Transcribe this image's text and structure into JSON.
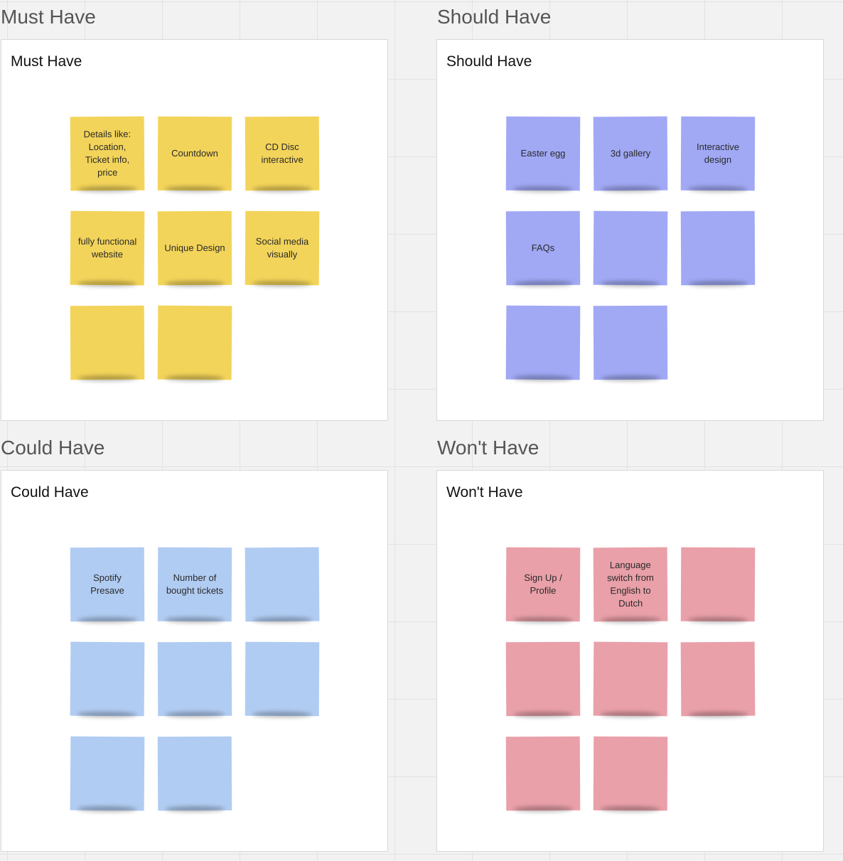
{
  "colors": {
    "must": "#f3d45a",
    "should": "#a1a9f5",
    "could": "#b1ccf2",
    "wont": "#e9a0a9",
    "board_background": "#f2f2f2"
  },
  "quadrants": {
    "must": {
      "label": "Must Have",
      "title": "Must Have",
      "notes": [
        {
          "text": "Details like: Location, Ticket info, price"
        },
        {
          "text": "Countdown"
        },
        {
          "text": "CD Disc interactive"
        },
        {
          "text": "fully functional website"
        },
        {
          "text": "Unique Design"
        },
        {
          "text": "Social media visually"
        },
        {
          "text": ""
        },
        {
          "text": ""
        }
      ]
    },
    "should": {
      "label": "Should Have",
      "title": "Should Have",
      "notes": [
        {
          "text": "Easter egg"
        },
        {
          "text": "3d gallery"
        },
        {
          "text": "Interactive design"
        },
        {
          "text": "FAQs"
        },
        {
          "text": ""
        },
        {
          "text": ""
        },
        {
          "text": ""
        },
        {
          "text": ""
        }
      ]
    },
    "could": {
      "label": "Could Have",
      "title": "Could Have",
      "notes": [
        {
          "text": "Spotify Presave"
        },
        {
          "text": "Number of bought tickets"
        },
        {
          "text": ""
        },
        {
          "text": ""
        },
        {
          "text": ""
        },
        {
          "text": ""
        },
        {
          "text": ""
        },
        {
          "text": ""
        }
      ]
    },
    "wont": {
      "label": "Won't Have",
      "title": "Won't Have",
      "notes": [
        {
          "text": "Sign Up / Profile"
        },
        {
          "text": "Language switch from English to Dutch"
        },
        {
          "text": ""
        },
        {
          "text": ""
        },
        {
          "text": ""
        },
        {
          "text": ""
        },
        {
          "text": ""
        },
        {
          "text": ""
        }
      ]
    }
  }
}
